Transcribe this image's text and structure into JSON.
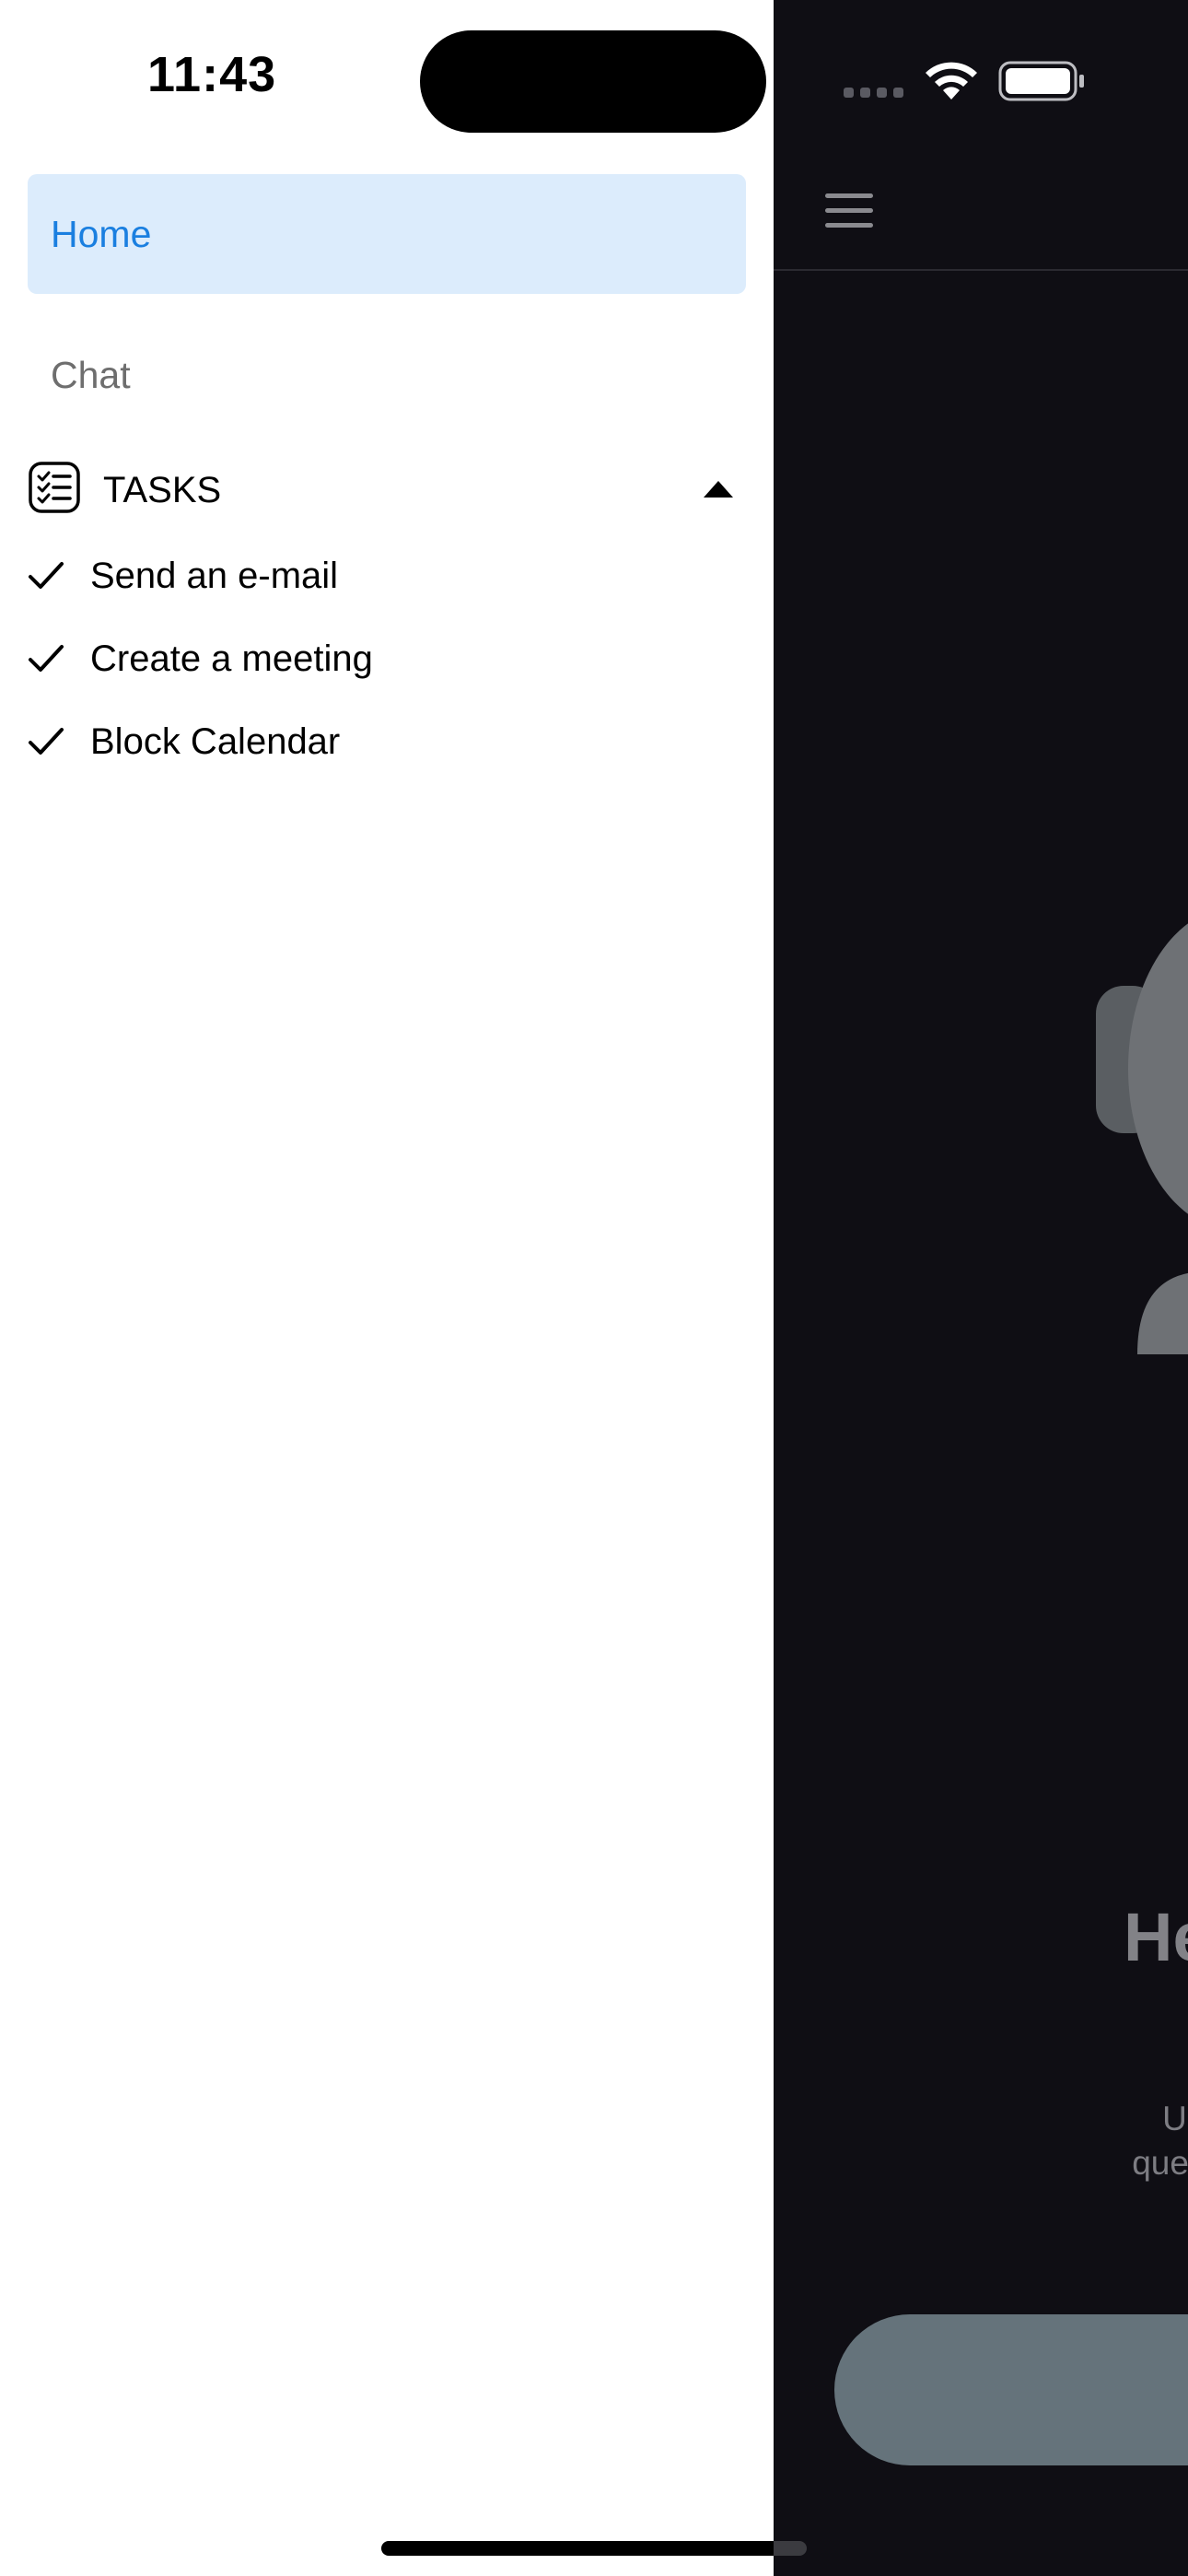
{
  "status_bar": {
    "time": "11:43"
  },
  "drawer": {
    "nav": [
      {
        "label": "Home",
        "selected": true,
        "color": "#1a7fe0",
        "background": "#dcecfc"
      },
      {
        "label": "Chat",
        "selected": false,
        "color": "#6e6e6e"
      }
    ],
    "tasks": {
      "title": "TASKS",
      "icon": "checklist-icon",
      "expanded": true,
      "toggle_icon": "caret-up-icon",
      "items": [
        {
          "label": "Send an e-mail",
          "icon": "checkmark-icon"
        },
        {
          "label": "Create a meeting",
          "icon": "checkmark-icon"
        },
        {
          "label": "Block Calendar",
          "icon": "checkmark-icon"
        }
      ]
    }
  },
  "main": {
    "menu_icon": "hamburger-menu-icon",
    "hero_title": "He",
    "hero_subtitle_lines": [
      "Using th",
      "questions ar"
    ],
    "background": "#0f0e14",
    "cta_color": "#65737b"
  }
}
